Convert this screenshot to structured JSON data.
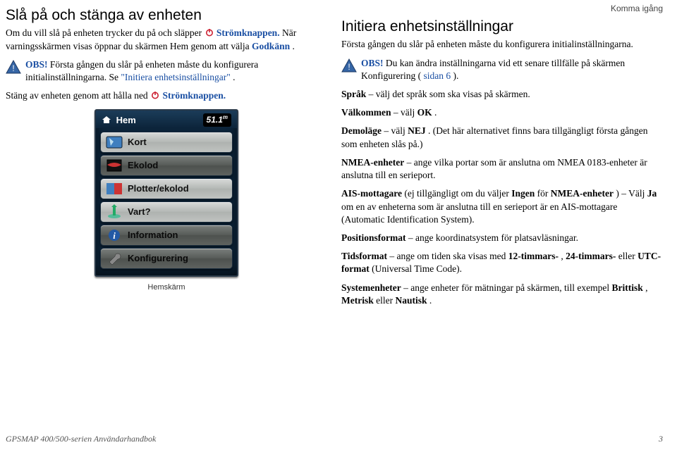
{
  "section_label": "Komma igång",
  "left": {
    "heading": "Slå på och stänga av enheten",
    "p1_a": "Om du vill slå på enheten trycker du på och släpper ",
    "p1_b": " Strömknappen.",
    "p1_c": " När varningsskärmen visas öppnar du skärmen Hem genom att välja ",
    "p1_d": "Godkänn",
    "p1_e": ".",
    "obs_label": "OBS!",
    "obs_text_a": " Första gången du slår på enheten måste du konfigurera initialinställningarna. Se ",
    "obs_text_b": "\"Initiera enhetsinställningar\"",
    "obs_text_c": ".",
    "p2_a": "Stäng av enheten genom att hålla ned ",
    "p2_b": " Strömknappen.",
    "device_caption": "Hemskärm",
    "device": {
      "title": "Hem",
      "depth": "51.1",
      "unit": "m",
      "items": [
        "Kort",
        "Ekolod",
        "Plotter/ekolod",
        "Vart?",
        "Information",
        "Konfigurering"
      ]
    }
  },
  "right": {
    "heading": "Initiera enhetsinställningar",
    "p1": "Första gången du slår på enheten måste du konfigurera initialinställningarna.",
    "obs_label": "OBS!",
    "obs_text_a": " Du kan ändra inställningarna vid ett senare tillfälle på skärmen Konfigurering (",
    "obs_link": "sidan 6",
    "obs_text_c": ").",
    "rows": {
      "sprak_a": "Språk",
      "sprak_b": " – välj det språk som ska visas på skärmen.",
      "valk_a": "Välkommen",
      "valk_b": " – välj ",
      "valk_c": "OK",
      "valk_d": ".",
      "demo_a": "Demoläge",
      "demo_b": " – välj ",
      "demo_c": "NEJ",
      "demo_d": ". (Det här alternativet finns bara tillgängligt första gången som enheten slås på.)",
      "nmea_a": "NMEA-enheter",
      "nmea_b": " – ange vilka portar som är anslutna om NMEA 0183-enheter är anslutna till en serieport.",
      "ais_a": "AIS-mottagare",
      "ais_b": " (ej tillgängligt om du väljer ",
      "ais_c": "Ingen",
      "ais_d": " för ",
      "ais_e": "NMEA-enheter",
      "ais_f": ") – Välj ",
      "ais_g": "Ja",
      "ais_h": " om en av enheterna som är anslutna till en serieport är en AIS-mottagare (Automatic Identification System).",
      "pos_a": "Positionsformat",
      "pos_b": " – ange koordinatsystem för platsavläsningar.",
      "tid_a": "Tidsformat",
      "tid_b": " – ange om tiden ska visas med ",
      "tid_c": "12-timmars-",
      "tid_d": ", ",
      "tid_e": "24-timmars-",
      "tid_f": " eller ",
      "tid_g": "UTC-format",
      "tid_h": " (Universal Time Code).",
      "sys_a": "Systemenheter",
      "sys_b": " – ange enheter för mätningar på skärmen, till exempel ",
      "sys_c": "Brittisk",
      "sys_d": ", ",
      "sys_e": "Metrisk",
      "sys_f": " eller ",
      "sys_g": "Nautisk",
      "sys_h": "."
    }
  },
  "footer": {
    "left": "GPSMAP 400/500-serien Användarhandbok",
    "right": "3"
  }
}
